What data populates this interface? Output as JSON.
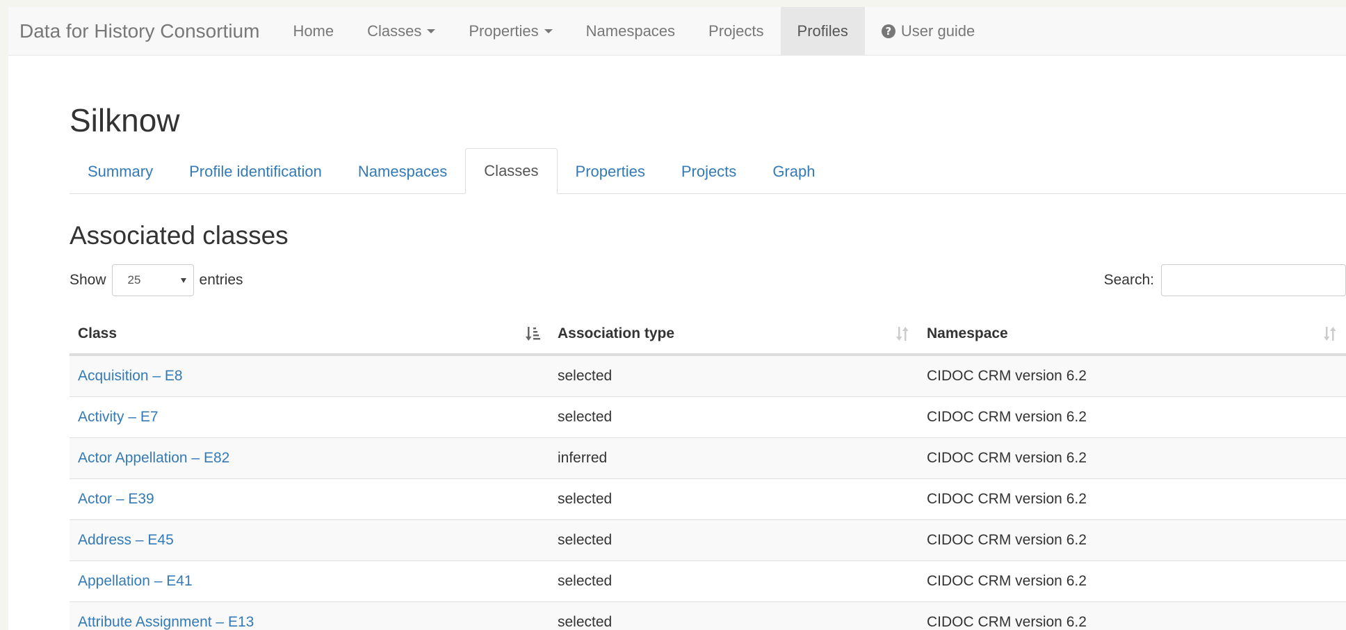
{
  "navbar": {
    "brand": "Data for History Consortium",
    "items": [
      {
        "label": "Home",
        "dropdown": false,
        "active": false
      },
      {
        "label": "Classes",
        "dropdown": true,
        "active": false
      },
      {
        "label": "Properties",
        "dropdown": true,
        "active": false
      },
      {
        "label": "Namespaces",
        "dropdown": false,
        "active": false
      },
      {
        "label": "Projects",
        "dropdown": false,
        "active": false
      },
      {
        "label": "Profiles",
        "dropdown": false,
        "active": true
      }
    ],
    "user_guide": {
      "label": "User guide",
      "icon": "question-circle-icon"
    }
  },
  "page": {
    "title": "Silknow",
    "tabs": [
      {
        "label": "Summary",
        "active": false
      },
      {
        "label": "Profile identification",
        "active": false
      },
      {
        "label": "Namespaces",
        "active": false
      },
      {
        "label": "Classes",
        "active": true
      },
      {
        "label": "Properties",
        "active": false
      },
      {
        "label": "Projects",
        "active": false
      },
      {
        "label": "Graph",
        "active": false
      }
    ],
    "section_title": "Associated classes"
  },
  "table_controls": {
    "show_label": "Show",
    "entries_value": "25",
    "entries_label": "entries",
    "search_label": "Search:",
    "search_value": ""
  },
  "table": {
    "columns": [
      {
        "label": "Class",
        "sort": "ascending"
      },
      {
        "label": "Association type",
        "sort": "none"
      },
      {
        "label": "Namespace",
        "sort": "none"
      }
    ],
    "rows": [
      {
        "class": "Acquisition – E8",
        "association": "selected",
        "namespace": "CIDOC CRM version 6.2"
      },
      {
        "class": "Activity – E7",
        "association": "selected",
        "namespace": "CIDOC CRM version 6.2"
      },
      {
        "class": "Actor Appellation – E82",
        "association": "inferred",
        "namespace": "CIDOC CRM version 6.2"
      },
      {
        "class": "Actor – E39",
        "association": "selected",
        "namespace": "CIDOC CRM version 6.2"
      },
      {
        "class": "Address – E45",
        "association": "selected",
        "namespace": "CIDOC CRM version 6.2"
      },
      {
        "class": "Appellation – E41",
        "association": "selected",
        "namespace": "CIDOC CRM version 6.2"
      },
      {
        "class": "Attribute Assignment – E13",
        "association": "selected",
        "namespace": "CIDOC CRM version 6.2"
      }
    ]
  },
  "colors": {
    "link": "#337ab7",
    "navbar_bg": "#f8f8f8",
    "active_nav_bg": "#e7e7e7",
    "stripe": "#f9f9f9"
  }
}
